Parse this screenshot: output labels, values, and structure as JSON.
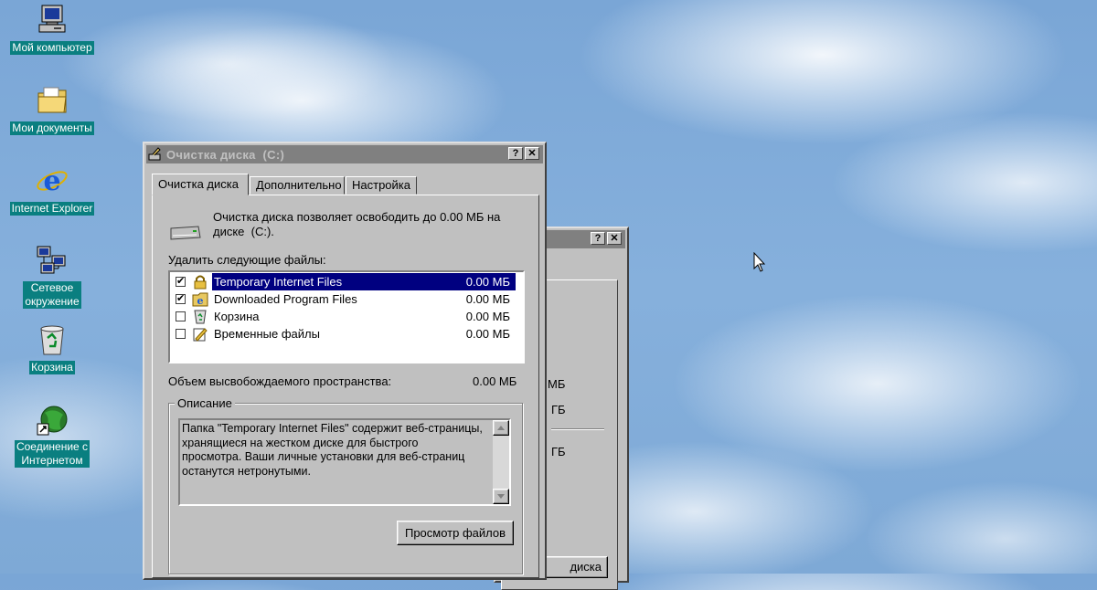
{
  "desktop": {
    "icons": [
      {
        "label": "Мой компьютер",
        "icon": "my-computer-icon"
      },
      {
        "label": "Мои документы",
        "icon": "my-documents-icon"
      },
      {
        "label": "Internet Explorer",
        "icon": "internet-explorer-icon"
      },
      {
        "label_line1": "Сетевое",
        "label_line2": "окружение",
        "icon": "network-neighborhood-icon"
      },
      {
        "label": "Корзина",
        "icon": "recycle-bin-icon"
      },
      {
        "label_line1": "Соединение с",
        "label_line2": "Интернетом",
        "icon": "connect-to-internet-icon"
      }
    ]
  },
  "back_window": {
    "help_btn": "?",
    "close_btn": "✕",
    "value1": "МБ",
    "value2": "ГБ",
    "value3": "ГБ",
    "bottom_btn": "диска"
  },
  "main_window": {
    "title": "Очистка диска  (C:)",
    "help_btn": "?",
    "close_btn": "✕",
    "tabs": [
      "Очистка диска",
      "Дополнительно",
      "Настройка"
    ],
    "intro_line1": "Очистка диска позволяет освободить до 0.00 МБ на",
    "intro_line2": "диске  (C:).",
    "delete_label": "Удалить следующие файлы:",
    "files": [
      {
        "name": "Temporary Internet Files",
        "size": "0.00 МБ",
        "checked": true,
        "selected": true,
        "icon": "lock-icon"
      },
      {
        "name": "Downloaded Program Files",
        "size": "0.00 МБ",
        "checked": true,
        "selected": false,
        "icon": "downloaded-program-icon"
      },
      {
        "name": "Корзина",
        "size": "0.00 МБ",
        "checked": false,
        "selected": false,
        "icon": "recycle-bin-icon"
      },
      {
        "name": "Временные файлы",
        "size": "0.00 МБ",
        "checked": false,
        "selected": false,
        "icon": "temp-files-icon"
      }
    ],
    "freed_label": "Объем высвобождаемого пространства:",
    "freed_value": "0.00 МБ",
    "description_title": "Описание",
    "description_lines": [
      "Папка \"Temporary Internet Files\" содержит веб-страницы,",
      "хранящиеся на жестком диске для быстрого",
      "просмотра. Ваши личные установки для веб-страниц",
      "останутся нетронутыми."
    ],
    "view_files_btn": "Просмотр файлов"
  },
  "colors": {
    "desktop_label_bg": "#0a7f80",
    "selection": "#000080",
    "window_face": "#c0c0c0",
    "inactive_title": "#808080"
  }
}
